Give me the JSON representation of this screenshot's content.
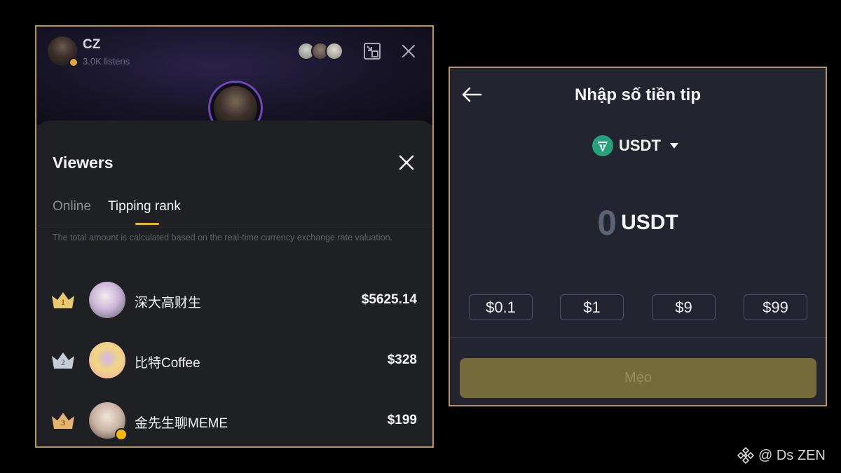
{
  "live_header": {
    "host_name": "CZ",
    "listens": "3.0K listens"
  },
  "viewers_sheet": {
    "title": "Viewers",
    "tabs": [
      {
        "label": "Online",
        "active": false
      },
      {
        "label": "Tipping rank",
        "active": true
      }
    ],
    "note": "The total amount is calculated based on the real-time currency exchange rate valuation.",
    "ranking": [
      {
        "rank": "1",
        "name": "深大高财生",
        "amount": "$5625.14",
        "crown_color": "#e9c870"
      },
      {
        "rank": "2",
        "name": "比特Coffee",
        "amount": "$328",
        "crown_color": "#c7cdd8"
      },
      {
        "rank": "3",
        "name": "金先生聊MEME",
        "amount": "$199",
        "crown_color": "#e2b46e"
      }
    ]
  },
  "tip_panel": {
    "title": "Nhập số tiền tip",
    "currency": "USDT",
    "amount_value": "0",
    "amount_unit": "USDT",
    "presets": [
      "$0.1",
      "$1",
      "$9",
      "$99"
    ],
    "submit_label": "Mẹo"
  },
  "watermark": {
    "text": "@ Ds ZEN"
  },
  "colors": {
    "accent_gold": "#f0b90b",
    "panel_border": "#b8935a",
    "submit_bg": "#756a3a",
    "usdt_teal": "#26a17b"
  }
}
